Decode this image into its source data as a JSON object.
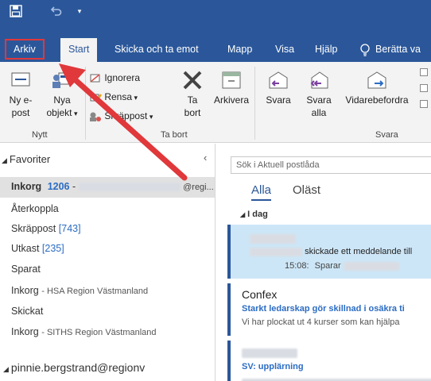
{
  "ribbon_tabs": {
    "file": "Arkiv",
    "start": "Start",
    "send_receive": "Skicka och ta emot",
    "folder": "Mapp",
    "view": "Visa",
    "help": "Hjälp",
    "tell_me": "Berätta va"
  },
  "ribbon": {
    "new_email_l1": "Ny e-",
    "new_email_l2": "post",
    "new_items_l1": "Nya",
    "new_items_l2": "objekt",
    "ignore": "Ignorera",
    "clean_up": "Rensa",
    "junk": "Skräppost",
    "delete_l1": "Ta",
    "delete_l2": "bort",
    "archive": "Arkivera",
    "reply": "Svara",
    "reply_all_l1": "Svara",
    "reply_all_l2": "alla",
    "forward": "Vidarebefordra",
    "group_new": "Nytt",
    "group_delete": "Ta bort",
    "group_respond": "Svara"
  },
  "nav": {
    "favorites": "Favoriter",
    "inbox_label": "Inkorg",
    "inbox_count": "1206",
    "inbox_email_suffix": "@regi...",
    "items": [
      {
        "label": "Återkoppla"
      },
      {
        "label": "Skräppost",
        "count": "[743]"
      },
      {
        "label": "Utkast",
        "count": "[235]"
      },
      {
        "label": "Sparat"
      },
      {
        "label": "Inkorg",
        "sub": "HSA Region Västmanland"
      },
      {
        "label": "Skickat"
      },
      {
        "label": "Inkorg",
        "sub": "SITHS Region Västmanland"
      }
    ],
    "account": "pinnie.bergstrand@regionv"
  },
  "list": {
    "search_placeholder": "Sök i Aktuell postlåda",
    "filter_all": "Alla",
    "filter_unread": "Oläst",
    "group_today": "I dag",
    "messages": [
      {
        "preview": "skickade ett meddelande till",
        "time": "15:08:",
        "status": "Sparar"
      },
      {
        "sender": "Confex",
        "subject": "Starkt ledarskap gör skillnad i osäkra ti",
        "preview": "Vi har plockat ut 4 kurser som kan hjälpa"
      },
      {
        "subject": "SV: upplärning"
      }
    ]
  }
}
